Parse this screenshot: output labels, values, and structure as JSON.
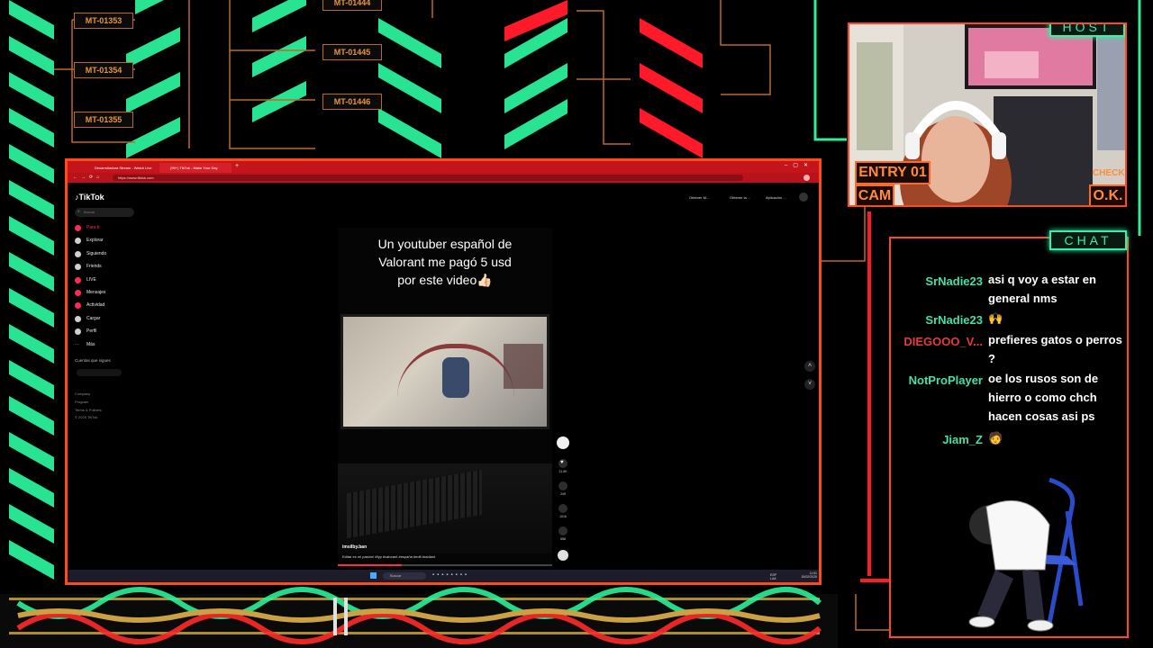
{
  "overlay": {
    "mt_labels": [
      "MT-01353",
      "MT-01354",
      "MT-01355",
      "MT-01444",
      "MT-01445",
      "MT-01446"
    ],
    "host_tag": "HOST",
    "chat_tag": "CHAT",
    "entry_tag": "ENTRY 01",
    "cam_tag": "CAM",
    "check_tag": "CHECK",
    "ok_tag": "O.K."
  },
  "browser": {
    "tabs": [
      {
        "label": "Desarrolladora Stream - Watch Live",
        "active": false
      },
      {
        "label": "(99+) TikTok - Make Your Day",
        "active": true
      }
    ],
    "url": "https://www.tiktok.com",
    "taskbar_search": "Buscar",
    "tray_lang": "ESP LAA",
    "tray_time": "11:51",
    "tray_date": "15/02/2025"
  },
  "tiktok": {
    "logo": "TikTok",
    "search_placeholder": "Buscar",
    "nav": [
      {
        "label": "Para ti",
        "icon": "home-icon",
        "active": true
      },
      {
        "label": "Explorar",
        "icon": "compass-icon",
        "active": false
      },
      {
        "label": "Siguiendo",
        "icon": "following-icon",
        "active": false
      },
      {
        "label": "Friends",
        "icon": "friends-icon",
        "active": false
      },
      {
        "label": "LIVE",
        "icon": "live-icon",
        "active": false
      },
      {
        "label": "Mensajes",
        "icon": "message-icon",
        "active": false
      },
      {
        "label": "Actividad",
        "icon": "activity-icon",
        "active": false
      },
      {
        "label": "Cargar",
        "icon": "upload-icon",
        "active": false
      },
      {
        "label": "Perfil",
        "icon": "profile-icon",
        "active": false
      },
      {
        "label": "Más",
        "icon": "more-icon",
        "active": false
      }
    ],
    "following_header": "Cuentas que sigues",
    "footer_links": [
      "Company",
      "Program",
      "Terms & Policies",
      "© 2025 TikTok"
    ],
    "top_actions": [
      "Obtener M...",
      "Obtener la ...",
      "Aplicación ..."
    ],
    "video": {
      "caption_title_lines": [
        "Un youtuber español de",
        "Valorant me pagó 5 usd",
        "por este video👍🏻"
      ],
      "author": "imsilby.ban",
      "description": "Editar es mi pasión! #fyp #valorant #españa #edit #radiant",
      "likes": "21.5K",
      "comments": "249",
      "saves": "1016",
      "shares": "658"
    }
  },
  "chat": {
    "messages": [
      {
        "user": "SrNadie23",
        "color": "#45e0a8",
        "text": "asi q voy a estar en general nms"
      },
      {
        "user": "SrNadie23",
        "color": "#45e0a8",
        "text": "🙌"
      },
      {
        "user": "DIEGOOO_V...",
        "color": "#e83a3a",
        "text": "prefieres gatos o perros ?"
      },
      {
        "user": "NotProPlayer",
        "color": "#45e0a8",
        "text": "oe los rusos son de hierro o como chch hacen cosas asi ps"
      },
      {
        "user": "Jiam_Z",
        "color": "#45e0a8",
        "text": "🧑"
      }
    ]
  },
  "colors": {
    "neon_green": "#38f0a8",
    "neon_red": "#ff1a2a",
    "frame_orange": "#ff4a1e",
    "tiktok_pink": "#fe2c55"
  }
}
